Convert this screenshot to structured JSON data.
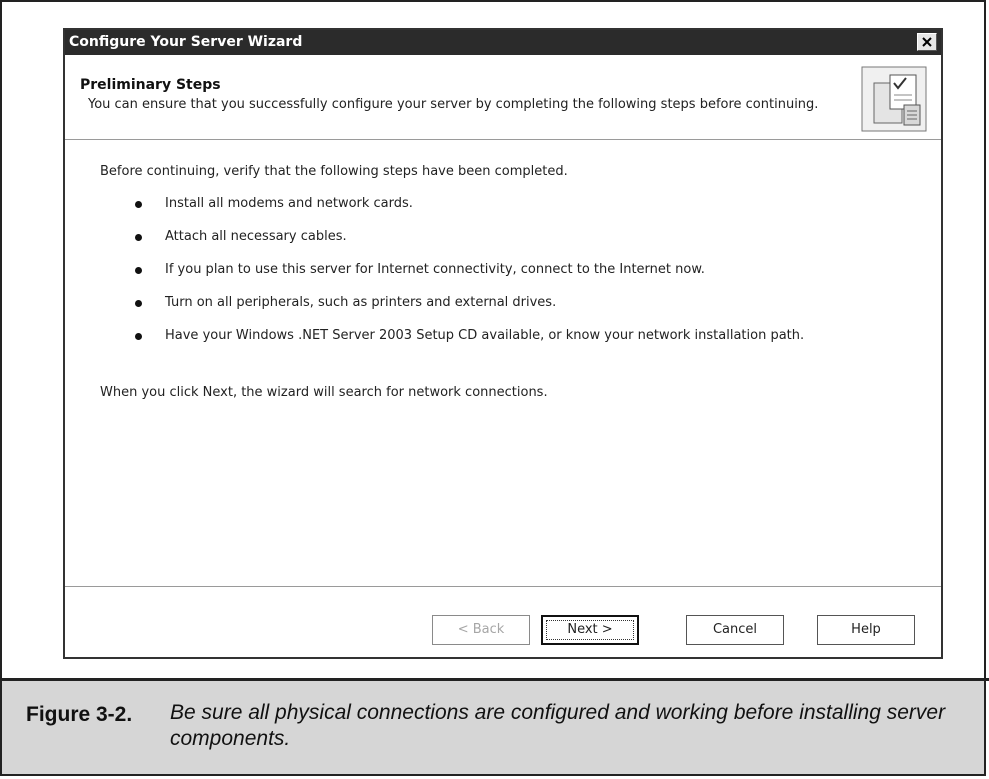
{
  "dialog": {
    "title": "Configure Your Server Wizard",
    "close_icon": "close-icon"
  },
  "header": {
    "title": "Preliminary Steps",
    "description": "You can ensure that you successfully configure your server by completing the following steps before continuing.",
    "graphic_icon": "checklist-clipboard-icon"
  },
  "content": {
    "intro": "Before continuing, verify that the following steps have been completed.",
    "steps": [
      "Install all modems and network cards.",
      "Attach all necessary cables.",
      "If you plan to use this server for Internet connectivity, connect to the Internet now.",
      "Turn on all peripherals, such as printers and external drives.",
      "Have your Windows .NET Server 2003 Setup CD available, or know your network installation path."
    ],
    "outro": "When you click Next, the wizard will search for network connections."
  },
  "buttons": {
    "back": "< Back",
    "next": "Next >",
    "cancel": "Cancel",
    "help": "Help"
  },
  "caption": {
    "figure_label": "Figure 3-2.",
    "text": "Be sure all physical connections are configured and working before installing server components."
  }
}
